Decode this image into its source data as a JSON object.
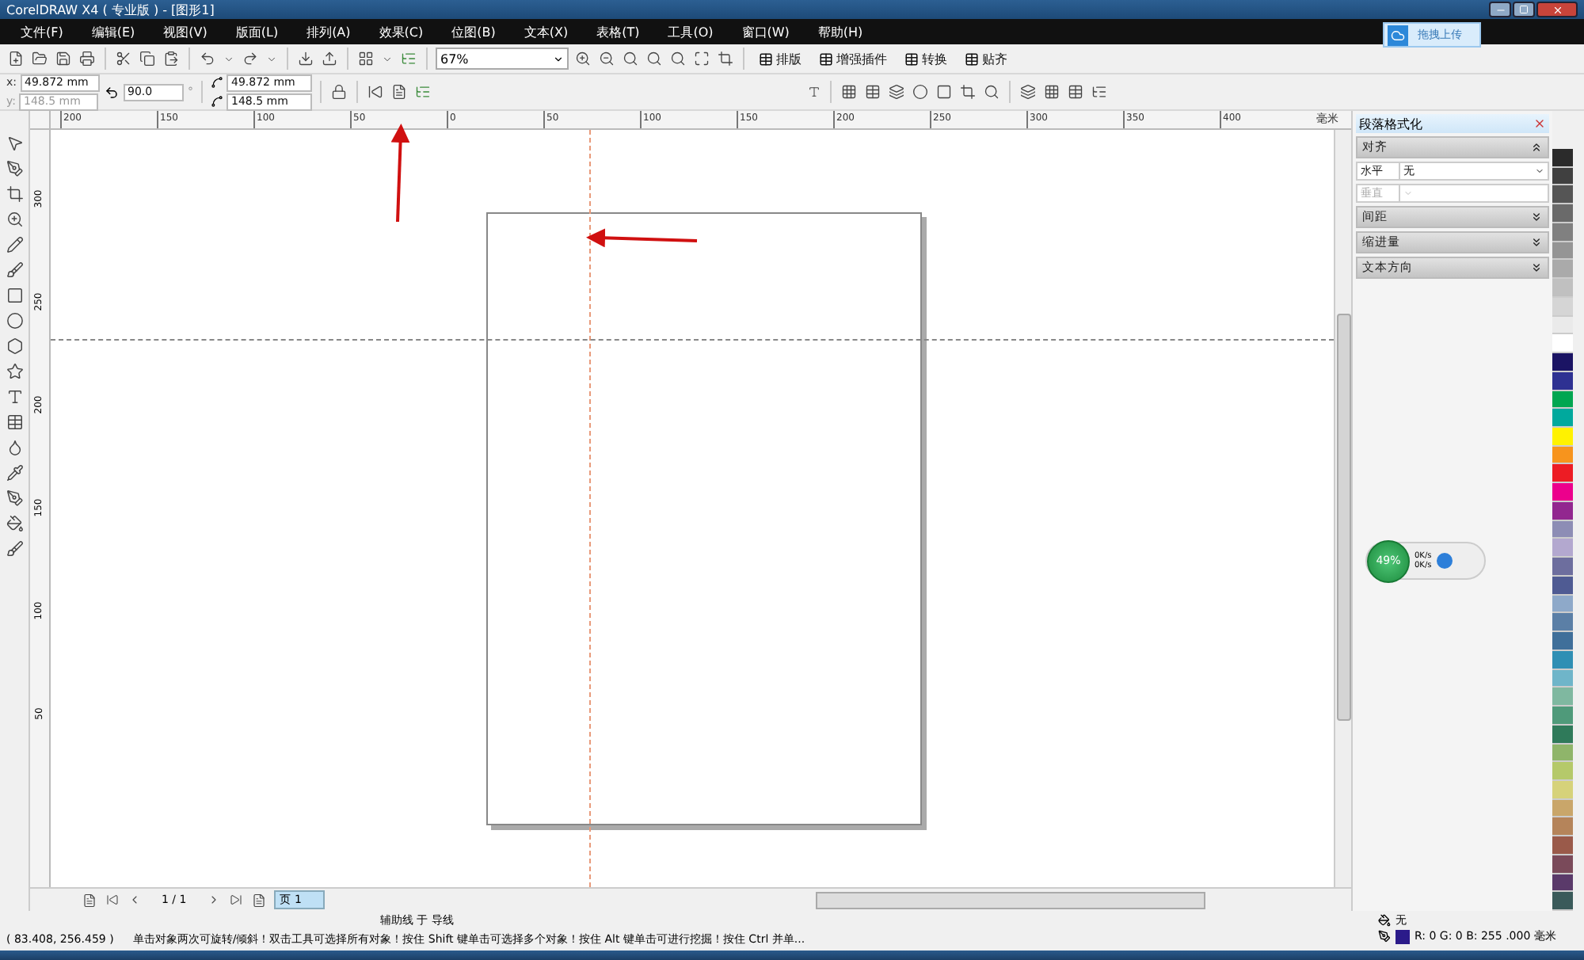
{
  "window": {
    "title": "CorelDRAW X4 ( 专业版 ) - [图形1]"
  },
  "menu": [
    "文件(F)",
    "编辑(E)",
    "视图(V)",
    "版面(L)",
    "排列(A)",
    "效果(C)",
    "位图(B)",
    "文本(X)",
    "表格(T)",
    "工具(O)",
    "窗口(W)",
    "帮助(H)"
  ],
  "upload_button": {
    "label": "拖拽上传"
  },
  "standard_toolbar": {
    "zoom": "67%",
    "buttons": [
      {
        "label": "排版"
      },
      {
        "label": "增强插件"
      },
      {
        "label": "转换"
      },
      {
        "label": "贴齐"
      }
    ]
  },
  "property_bar": {
    "x_label": "x:",
    "x": "49.872 mm",
    "y_label": "y:",
    "y": "148.5 mm",
    "angle": "90.0",
    "degree": "°",
    "width": "49.872 mm",
    "height": "148.5 mm"
  },
  "ruler": {
    "horizontal": [
      "200",
      "150",
      "100",
      "50",
      "0",
      "50",
      "100",
      "150",
      "200",
      "250",
      "300",
      "350",
      "400"
    ],
    "unit": "毫米",
    "vertical": [
      "300",
      "250",
      "200",
      "150",
      "100",
      "50"
    ]
  },
  "docker": {
    "title": "段落格式化",
    "sections": [
      {
        "title": "对齐",
        "expanded": true,
        "rows": [
          {
            "label": "水平",
            "value": "无",
            "disabled": false
          },
          {
            "label": "垂直",
            "disabled": true
          }
        ]
      },
      {
        "title": "间距",
        "expanded": false
      },
      {
        "title": "缩进量",
        "expanded": false
      },
      {
        "title": "文本方向",
        "expanded": false
      }
    ]
  },
  "network_widget": {
    "percent": "49%",
    "upload": "0K/s",
    "download": "0K/s"
  },
  "page_nav": {
    "counter": "1 / 1",
    "tabs": [
      {
        "label": "页 1",
        "selected": true
      }
    ]
  },
  "status_bar": {
    "guide": "辅助线 于 导线",
    "coordinates": "( 83.408, 256.459 )",
    "hint": "单击对象两次可旋转/倾斜！双击工具可选择所有对象！按住 Shift 键单击可选择多个对象！按住 Alt 键单击可进行挖掘！按住 Ctrl 并单...",
    "fill": "无",
    "outline": "R: 0 G: 0 B: 255  .000 毫米"
  },
  "palette": [
    {
      "color": "#2b2b2b"
    },
    {
      "color": "#404040"
    },
    {
      "color": "#555555"
    },
    {
      "color": "#6a6a6a"
    },
    {
      "color": "#808080"
    },
    {
      "color": "#959595"
    },
    {
      "color": "#aaaaaa"
    },
    {
      "color": "#c0c0c0"
    },
    {
      "color": "#d5d5d5"
    },
    {
      "color": "#eaeaea"
    },
    {
      "color": "#ffffff"
    },
    {
      "color": "#1b1464"
    },
    {
      "color": "#2e3192"
    },
    {
      "color": "#00a651"
    },
    {
      "color": "#00a99d"
    },
    {
      "color": "#fff200"
    },
    {
      "color": "#f7941d"
    },
    {
      "color": "#ed1c24"
    },
    {
      "color": "#ec008c"
    },
    {
      "color": "#92278f"
    },
    {
      "color": "#8d8db5"
    },
    {
      "color": "#b3a8cf"
    },
    {
      "color": "#6d6e9e"
    },
    {
      "color": "#4f5b93"
    },
    {
      "color": "#8ea9c9"
    },
    {
      "color": "#5b7fa6"
    },
    {
      "color": "#3f6f9a"
    },
    {
      "color": "#2f8fb4"
    },
    {
      "color": "#6fb5c9"
    },
    {
      "color": "#7fb8a0"
    },
    {
      "color": "#4f9a7a"
    },
    {
      "color": "#2f7a5a"
    },
    {
      "color": "#8fb56a"
    },
    {
      "color": "#b5c96a"
    },
    {
      "color": "#d6d27a"
    },
    {
      "color": "#c9a66a"
    },
    {
      "color": "#b5845a"
    },
    {
      "color": "#9a5a4a"
    },
    {
      "color": "#7a4a5a"
    },
    {
      "color": "#5a3a6a"
    },
    {
      "color": "#3a5a5a"
    }
  ]
}
